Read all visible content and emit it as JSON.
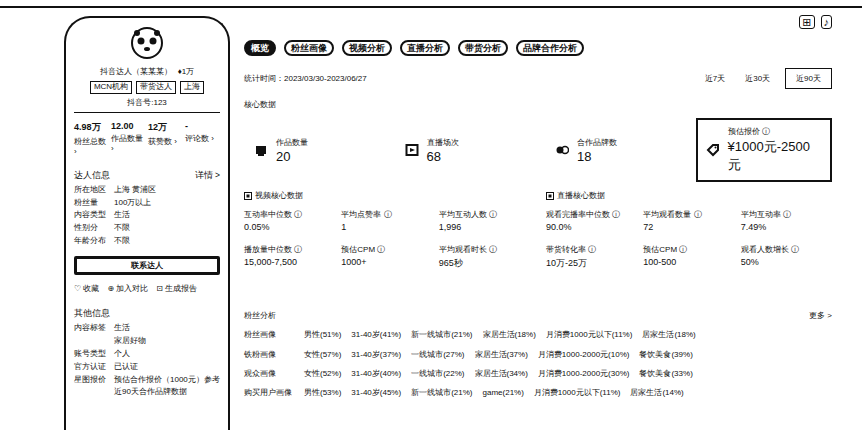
{
  "header_icons": [
    "⊞",
    "♪"
  ],
  "profile": {
    "name": "抖音达人（某某某）",
    "badge": "♦1万",
    "tags": [
      "MCN机构",
      "带货达人",
      "上海"
    ],
    "sub": "抖音号:123",
    "stats": [
      {
        "value": "4.98万",
        "label": "粉丝总数 ›"
      },
      {
        "value": "12.00",
        "label": "作品数量 ›"
      },
      {
        "value": "12万",
        "label": "获赞数 ›"
      },
      {
        "value": "-",
        "label": "评论数 ›"
      }
    ],
    "info": {
      "title": "达人信息",
      "more": "详情 >",
      "rows": [
        {
          "key": "所在地区",
          "value": "上海 黄浦区"
        },
        {
          "key": "粉丝量",
          "value": "100万以上"
        },
        {
          "key": "内容类型",
          "value": "生活"
        },
        {
          "key": "性别分",
          "value": "不限"
        },
        {
          "key": "年龄分布",
          "value": "不限"
        }
      ]
    },
    "button": "联系达人",
    "actions": [
      {
        "icon": "♡",
        "label": "收藏"
      },
      {
        "icon": "⊕",
        "label": "加入对比"
      },
      {
        "icon": "⊡",
        "label": "生成报告"
      }
    ],
    "other": {
      "title": "其他信息",
      "rows": [
        {
          "key": "内容标签",
          "value": "生活"
        },
        {
          "key": "",
          "value": "家居好物"
        },
        {
          "key": "账号类型",
          "value": "个人"
        },
        {
          "key": "官方认证",
          "value": "已认证"
        },
        {
          "key": "星图报价",
          "value": "预估合作报价（1000元）参考"
        },
        {
          "key": "",
          "value": "近90天合作品牌数据"
        }
      ]
    }
  },
  "main": {
    "tabs": [
      {
        "label": "概览",
        "selected": true
      },
      {
        "label": "粉丝画像",
        "selected": false
      },
      {
        "label": "视频分析",
        "selected": false
      },
      {
        "label": "直播分析",
        "selected": false
      },
      {
        "label": "带货分析",
        "selected": false
      },
      {
        "label": "品牌合作分析",
        "selected": false
      }
    ],
    "date": "统计时间：2023/03/30-2023/06/27",
    "ranges": [
      {
        "label": "近7天",
        "selected": false
      },
      {
        "label": "近30天",
        "selected": false
      },
      {
        "label": "近90天",
        "selected": true
      }
    ],
    "core_title": "核心数据",
    "cards": [
      {
        "label": "作品数量",
        "value": "20",
        "highlighted": false
      },
      {
        "label": "直播场次",
        "value": "68",
        "highlighted": false
      },
      {
        "label": "合作品牌数",
        "value": "18",
        "highlighted": false
      },
      {
        "label": "预估报价 ⓘ",
        "value": "¥1000元-2500元",
        "highlighted": true
      }
    ],
    "groups": [
      {
        "title": "视频核心数据",
        "metrics": [
          {
            "label": "互动率中位数 ⓘ",
            "value": "0.05%"
          },
          {
            "label": "平均点赞率 ⓘ",
            "value": "1"
          },
          {
            "label": "平均互动人数 ⓘ",
            "value": "1,996"
          },
          {
            "label": "播放量中位数 ⓘ",
            "value": "15,000-7,500"
          },
          {
            "label": "预估CPM ⓘ",
            "value": "1000+"
          },
          {
            "label": "平均观看时长 ⓘ",
            "value": "965秒"
          }
        ]
      },
      {
        "title": "直播核心数据",
        "metrics": [
          {
            "label": "观看完播率中位数 ⓘ",
            "value": "90.0%"
          },
          {
            "label": "平均观看数量 ⓘ",
            "value": "72"
          },
          {
            "label": "平均互动率 ⓘ",
            "value": "7.49%"
          },
          {
            "label": "带货转化率 ⓘ",
            "value": "10万-25万"
          },
          {
            "label": "预估CPM ⓘ",
            "value": "100-500"
          },
          {
            "label": "观看人数增长 ⓘ",
            "value": "50%"
          }
        ]
      }
    ],
    "fans": {
      "title": "粉丝分析",
      "more": "更多 >",
      "rows": [
        {
          "label": "粉丝画像",
          "chips": [
            "男性(51%)",
            "31-40岁(41%)",
            "新一线城市(21%)",
            "家居生活(18%)",
            "月消费1000元以下(11%)",
            "居家生活(18%)"
          ]
        },
        {
          "label": "铁粉画像",
          "chips": [
            "女性(57%)",
            "31-40岁(37%)",
            "一线城市(27%)",
            "家居生活(37%)",
            "月消费1000-2000元(10%)",
            "餐饮美食(39%)"
          ]
        },
        {
          "label": "观众画像",
          "chips": [
            "女性(52%)",
            "31-40岁(40%)",
            "一线城市(22%)",
            "家居生活(34%)",
            "月消费1000-2000元(30%)",
            "餐饮美食(33%)"
          ]
        },
        {
          "label": "购买用户画像",
          "chips": [
            "男性(53%)",
            "31-40岁(45%)",
            "新一线城市(21%)",
            "game(21%)",
            "月消费1000元以下(11%)",
            "居家生活(14%)"
          ]
        }
      ]
    }
  }
}
